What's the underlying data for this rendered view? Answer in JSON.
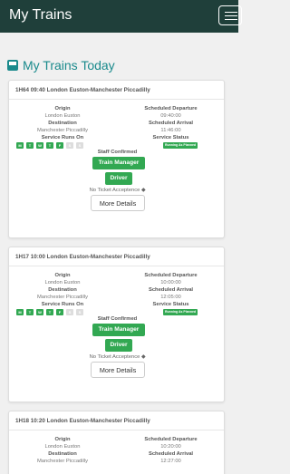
{
  "header": {
    "app_title": "My Trains"
  },
  "page": {
    "heading": "My Trains Today"
  },
  "labels": {
    "origin": "Origin",
    "destination": "Destination",
    "service_runs_on": "Service Runs On",
    "scheduled_departure": "Scheduled Departure",
    "scheduled_arrival": "Scheduled Arrival",
    "service_status": "Service Status",
    "staff_confirmed": "Staff Confirmed",
    "no_ticket": "No Ticket Acceptence",
    "more_details": "More Details"
  },
  "days": [
    "M",
    "T",
    "W",
    "T",
    "F",
    "S",
    "S"
  ],
  "colors": {
    "navbar": "#1f3f3a",
    "accent": "#1a8a8c",
    "status_green": "#32a852"
  },
  "services": [
    {
      "title": "1H64 09:40 London Euston-Manchester Piccadilly",
      "origin": "London Euston",
      "destination": "Manchester Piccadilly",
      "departure": "09:40:00",
      "arrival": "11:46:00",
      "status": "Running As Planned",
      "days_active": [
        true,
        true,
        true,
        true,
        true,
        false,
        false
      ],
      "staff": [
        "Train Manager",
        "Driver"
      ]
    },
    {
      "title": "1H17 10:00 London Euston-Manchester Piccadilly",
      "origin": "London Euston",
      "destination": "Manchester Piccadilly",
      "departure": "10:00:00",
      "arrival": "12:05:00",
      "status": "Running As Planned",
      "days_active": [
        true,
        true,
        true,
        true,
        true,
        false,
        false
      ],
      "staff": [
        "Train Manager",
        "Driver"
      ]
    },
    {
      "title": "1H18 10:20 London Euston-Manchester Piccadilly",
      "origin": "London Euston",
      "destination": "Manchester Piccadilly",
      "departure": "10:20:00",
      "arrival": "12:27:00"
    }
  ]
}
